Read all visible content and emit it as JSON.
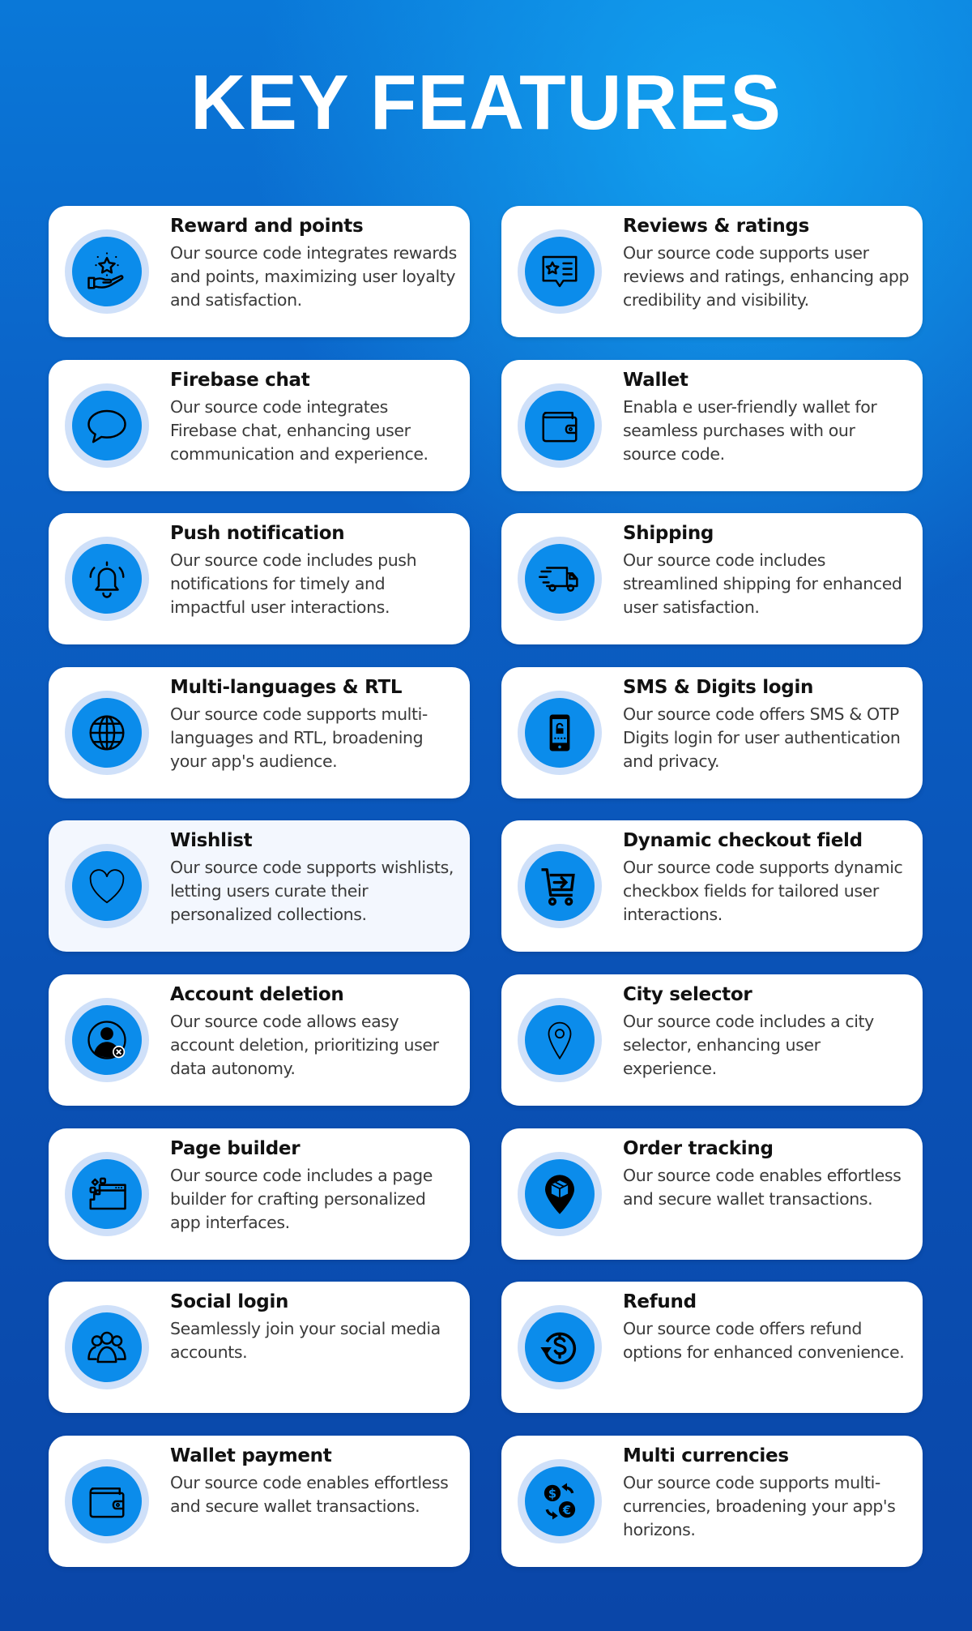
{
  "header": {
    "title": "KEY FEATURES"
  },
  "colors": {
    "icon_disc": "#0b8ceb",
    "icon_ring": "#cfe0f9",
    "card": "#ffffff"
  },
  "features": [
    {
      "title": "Reward and points",
      "description": "Our source code integrates rewards and points, maximizing user loyalty and satisfaction.",
      "icon": "reward-hand-star-icon"
    },
    {
      "title": "Reviews & ratings",
      "description": "Our source code supports user reviews and ratings, enhancing app credibility and visibility.",
      "icon": "review-star-message-icon"
    },
    {
      "title": "Firebase chat",
      "description": "Our source code integrates Firebase chat, enhancing user communication and experience.",
      "icon": "chat-bubble-icon"
    },
    {
      "title": "Wallet",
      "description": "Enabla e user-friendly wallet for seamless purchases with our source code.",
      "icon": "wallet-icon"
    },
    {
      "title": "Push notification",
      "description": "Our source code includes push notifications for timely and impactful user interactions.",
      "icon": "bell-icon"
    },
    {
      "title": "Shipping",
      "description": "Our source code includes streamlined shipping for enhanced user satisfaction.",
      "icon": "delivery-truck-icon"
    },
    {
      "title": "Multi-languages & RTL",
      "description": "Our source code supports multi-languages and RTL, broadening your app's audience.",
      "icon": "globe-icon"
    },
    {
      "title": "SMS & Digits login",
      "description": "Our source code offers SMS & OTP Digits login for user authentication and privacy.",
      "icon": "phone-lock-icon"
    },
    {
      "title": "Wishlist",
      "description": "Our source code supports wishlists, letting users curate their personalized collections.",
      "icon": "heart-icon"
    },
    {
      "title": "Dynamic checkout field",
      "description": "Our source code supports dynamic checkbox fields for tailored user interactions.",
      "icon": "cart-arrow-icon"
    },
    {
      "title": "Account deletion",
      "description": "Our source code allows easy account deletion, prioritizing user data autonomy.",
      "icon": "user-remove-icon"
    },
    {
      "title": "City selector",
      "description": "Our source code includes a city selector, enhancing user experience.",
      "icon": "map-pin-icon"
    },
    {
      "title": "Page builder",
      "description": "Our source code includes a page builder for crafting personalized app interfaces.",
      "icon": "page-builder-icon"
    },
    {
      "title": "Order tracking",
      "description": "Our source code enables effortless and secure wallet transactions.",
      "icon": "location-box-icon"
    },
    {
      "title": "Social login",
      "description": "Seamlessly join your social media accounts.",
      "icon": "users-group-icon"
    },
    {
      "title": "Refund",
      "description": "Our source code offers refund options for enhanced convenience.",
      "icon": "refund-dollar-icon"
    },
    {
      "title": "Wallet payment",
      "description": "Our source code enables effortless and secure wallet transactions.",
      "icon": "wallet-icon"
    },
    {
      "title": "Multi currencies",
      "description": "Our source code supports multi-currencies, broadening your app's horizons.",
      "icon": "currency-exchange-icon"
    }
  ]
}
